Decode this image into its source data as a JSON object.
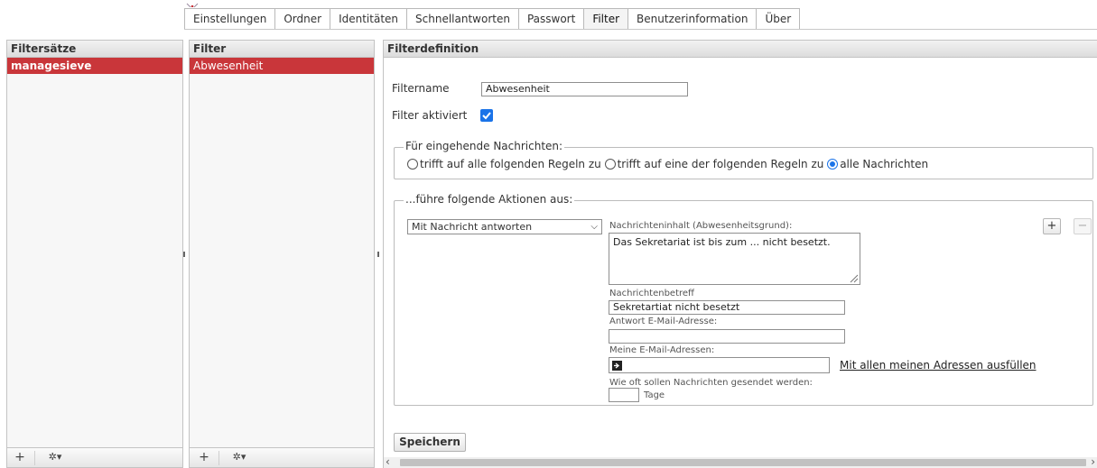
{
  "tabs": [
    "Einstellungen",
    "Ordner",
    "Identitäten",
    "Schnellantworten",
    "Passwort",
    "Filter",
    "Benutzerinformation",
    "Über"
  ],
  "active_tab": "Filter",
  "filtersets": {
    "header": "Filtersätze",
    "items": [
      "managesieve"
    ]
  },
  "filters": {
    "header": "Filter",
    "items": [
      "Abwesenheit"
    ]
  },
  "footer": {
    "add": "+",
    "gear": "✲▾"
  },
  "definition": {
    "header": "Filterdefinition",
    "filtername_label": "Filtername",
    "filtername_value": "Abwesenheit",
    "enabled_label": "Filter aktiviert",
    "enabled": true,
    "incoming_legend": "Für eingehende Nachrichten:",
    "incoming_options": [
      "trifft auf alle folgenden Regeln zu",
      "trifft auf eine der folgenden Regeln zu",
      "alle Nachrichten"
    ],
    "incoming_selected": 2,
    "actions_legend": "...führe folgende Aktionen aus:",
    "action_select": "Mit Nachricht antworten",
    "body_label": "Nachrichteninhalt (Abwesenheitsgrund):",
    "body_value": "Das Sekretariat ist bis zum ... nicht besetzt.",
    "subject_label": "Nachrichtenbetreff",
    "subject_value": "Sekretartiat nicht besetzt",
    "reply_label": "Antwort E-Mail-Adresse:",
    "reply_value": "",
    "my_addresses_label": "Meine E-Mail-Adressen:",
    "fill_link": "Mit allen meinen Adressen ausfüllen",
    "how_often_label": "Wie oft sollen Nachrichten gesendet werden:",
    "days_value": "",
    "days_unit": "Tage",
    "add_action": "+",
    "remove_action": "−",
    "save": "Speichern"
  },
  "colors": {
    "selection": "#c9363a",
    "accent": "#1a73e8"
  }
}
